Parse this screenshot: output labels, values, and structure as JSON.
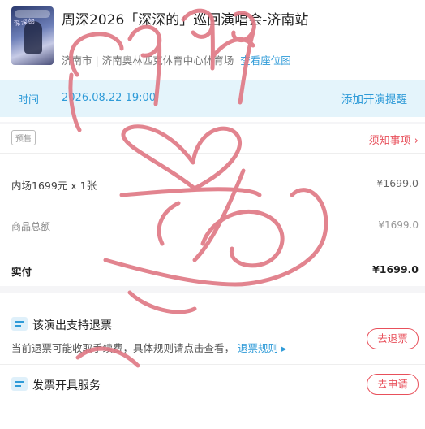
{
  "event": {
    "poster_text": "深深的",
    "title": "周深2026「深深的」巡回演唱会-济南站",
    "city": "济南市",
    "venue": "济南奥林匹克体育中心体育场",
    "seat_map_label": "查看座位图",
    "time_label": "时间",
    "time_value": "2026.08.22 19:00",
    "remind_label": "添加开演提醒"
  },
  "order": {
    "badge": "预售",
    "notice_label": "须知事项 ›",
    "item_label": "内场1699元 x 1张",
    "item_price": "¥1699.0",
    "subtotal_label": "商品总额",
    "subtotal_value": "¥1699.0",
    "paid_label": "实付",
    "paid_value": "¥1699.0"
  },
  "refund": {
    "title": "该演出支持退票",
    "desc": "当前退票可能收取手续费，具体规则请点击查看，",
    "rule_link": "退票规则 ▸",
    "button": "去退票"
  },
  "invoice": {
    "title": "发票开具服务",
    "button": "去申请"
  },
  "colors": {
    "accent_blue": "#2f9bd8",
    "accent_red": "#e8505b",
    "scribble_pink": "#e07a86"
  }
}
